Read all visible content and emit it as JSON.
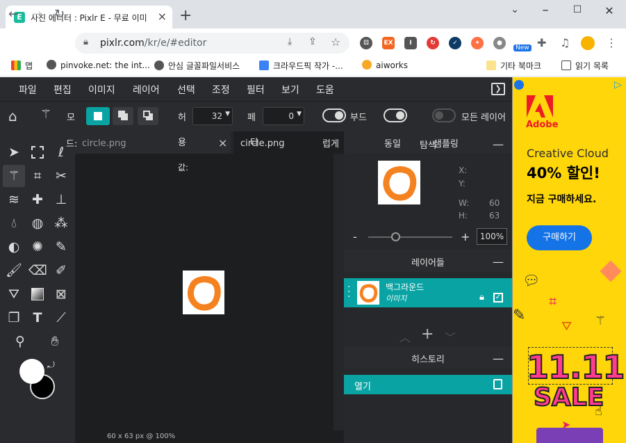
{
  "browser": {
    "tab_title": "사진 에디터 : Pixlr E - 무료 이미",
    "tab_icon_letter": "E",
    "new_tab": "+",
    "url_main": "pixlr.com",
    "url_path": "/kr/e/#editor",
    "bookmarks": [
      {
        "label": "앱",
        "icon": "apps-icon"
      },
      {
        "label": "pinvoke.net: the int...",
        "icon": "globe-icon"
      },
      {
        "label": "안심 글꼴파일서비스",
        "icon": "globe-icon"
      },
      {
        "label": "크라우드픽 작가 -...",
        "icon": "image-icon"
      },
      {
        "label": "aiworks",
        "icon": "aiworks-icon"
      }
    ],
    "other_bookmarks": "기타 북마크",
    "reading_list": "읽기 목록",
    "ext_new_badge": "New"
  },
  "menu": [
    "파일",
    "편집",
    "이미지",
    "레이어",
    "선택",
    "조정",
    "필터",
    "보기",
    "도움"
  ],
  "options": {
    "label_mo": "모",
    "label_height": "허",
    "tolerance_value": "32",
    "label_feather": "페",
    "feather_value": "0",
    "label_smooth": "부드",
    "label_all_layers": "모든 레이어"
  },
  "doc_tabs": {
    "tab1": "circle.png",
    "overlay_label_1": "드:",
    "overlay_label_2": "용",
    "overlay_label_3": "값:",
    "tab2": "circle.png",
    "overlay_label_4": "타",
    "overlay_label_5": "럽게",
    "close": "×"
  },
  "status": "60 x 63 px @ 100%",
  "navigator": {
    "tab_overlay": "동일",
    "title": "탐색",
    "title_overlay": "샘플링",
    "x_label": "X:",
    "y_label": "Y:",
    "w_label": "W:",
    "w_value": "60",
    "h_label": "H:",
    "h_value": "63",
    "zoom_minus": "-",
    "zoom_plus": "+",
    "zoom": "100%",
    "zoom_level": 0.1
  },
  "layers": {
    "title": "레이어들",
    "items": [
      {
        "name": "백그라운드",
        "sub": "이미지"
      }
    ]
  },
  "history": {
    "title": "히스토리",
    "items": [
      "열기"
    ]
  },
  "ad": {
    "brand": "Adobe",
    "headline": "Creative Cloud",
    "offer": "40% 할인!",
    "cta_text": "지금 구매하세요.",
    "button": "구매하기",
    "sale_big": "11.11",
    "sale_word": "SALE"
  },
  "colors": {
    "accent": "#0aa3a3",
    "orange": "#f58220",
    "ad_yellow": "#ffd60a",
    "adobe_red": "#ed1c24",
    "ad_blue": "#1473e6"
  }
}
